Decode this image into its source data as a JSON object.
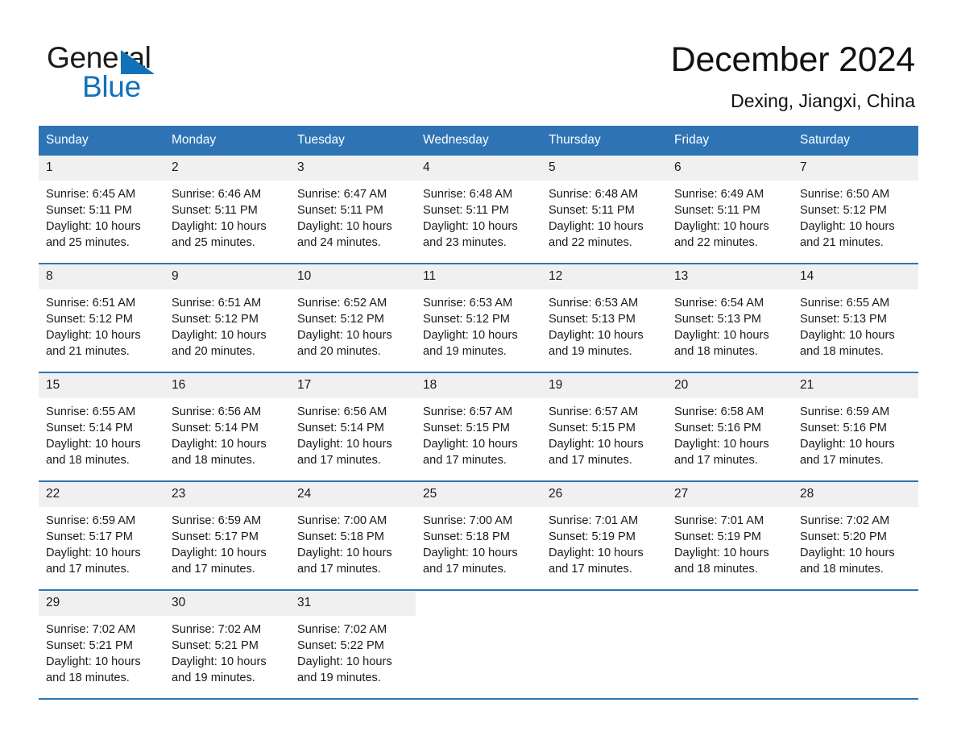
{
  "brand": {
    "name_top": "General",
    "name_bottom": "Blue",
    "triangle_color": "#1172ba"
  },
  "header": {
    "title": "December 2024",
    "subtitle": "Dexing, Jiangxi, China"
  },
  "theme": {
    "header_blue": "#2e74b5",
    "daynum_band": "#f0f0f0",
    "text": "#1a1a1a"
  },
  "weekdays": [
    "Sunday",
    "Monday",
    "Tuesday",
    "Wednesday",
    "Thursday",
    "Friday",
    "Saturday"
  ],
  "weeks": [
    [
      {
        "day": "1",
        "sunrise": "Sunrise: 6:45 AM",
        "sunset": "Sunset: 5:11 PM",
        "daylight_1": "Daylight: 10 hours",
        "daylight_2": "and 25 minutes."
      },
      {
        "day": "2",
        "sunrise": "Sunrise: 6:46 AM",
        "sunset": "Sunset: 5:11 PM",
        "daylight_1": "Daylight: 10 hours",
        "daylight_2": "and 25 minutes."
      },
      {
        "day": "3",
        "sunrise": "Sunrise: 6:47 AM",
        "sunset": "Sunset: 5:11 PM",
        "daylight_1": "Daylight: 10 hours",
        "daylight_2": "and 24 minutes."
      },
      {
        "day": "4",
        "sunrise": "Sunrise: 6:48 AM",
        "sunset": "Sunset: 5:11 PM",
        "daylight_1": "Daylight: 10 hours",
        "daylight_2": "and 23 minutes."
      },
      {
        "day": "5",
        "sunrise": "Sunrise: 6:48 AM",
        "sunset": "Sunset: 5:11 PM",
        "daylight_1": "Daylight: 10 hours",
        "daylight_2": "and 22 minutes."
      },
      {
        "day": "6",
        "sunrise": "Sunrise: 6:49 AM",
        "sunset": "Sunset: 5:11 PM",
        "daylight_1": "Daylight: 10 hours",
        "daylight_2": "and 22 minutes."
      },
      {
        "day": "7",
        "sunrise": "Sunrise: 6:50 AM",
        "sunset": "Sunset: 5:12 PM",
        "daylight_1": "Daylight: 10 hours",
        "daylight_2": "and 21 minutes."
      }
    ],
    [
      {
        "day": "8",
        "sunrise": "Sunrise: 6:51 AM",
        "sunset": "Sunset: 5:12 PM",
        "daylight_1": "Daylight: 10 hours",
        "daylight_2": "and 21 minutes."
      },
      {
        "day": "9",
        "sunrise": "Sunrise: 6:51 AM",
        "sunset": "Sunset: 5:12 PM",
        "daylight_1": "Daylight: 10 hours",
        "daylight_2": "and 20 minutes."
      },
      {
        "day": "10",
        "sunrise": "Sunrise: 6:52 AM",
        "sunset": "Sunset: 5:12 PM",
        "daylight_1": "Daylight: 10 hours",
        "daylight_2": "and 20 minutes."
      },
      {
        "day": "11",
        "sunrise": "Sunrise: 6:53 AM",
        "sunset": "Sunset: 5:12 PM",
        "daylight_1": "Daylight: 10 hours",
        "daylight_2": "and 19 minutes."
      },
      {
        "day": "12",
        "sunrise": "Sunrise: 6:53 AM",
        "sunset": "Sunset: 5:13 PM",
        "daylight_1": "Daylight: 10 hours",
        "daylight_2": "and 19 minutes."
      },
      {
        "day": "13",
        "sunrise": "Sunrise: 6:54 AM",
        "sunset": "Sunset: 5:13 PM",
        "daylight_1": "Daylight: 10 hours",
        "daylight_2": "and 18 minutes."
      },
      {
        "day": "14",
        "sunrise": "Sunrise: 6:55 AM",
        "sunset": "Sunset: 5:13 PM",
        "daylight_1": "Daylight: 10 hours",
        "daylight_2": "and 18 minutes."
      }
    ],
    [
      {
        "day": "15",
        "sunrise": "Sunrise: 6:55 AM",
        "sunset": "Sunset: 5:14 PM",
        "daylight_1": "Daylight: 10 hours",
        "daylight_2": "and 18 minutes."
      },
      {
        "day": "16",
        "sunrise": "Sunrise: 6:56 AM",
        "sunset": "Sunset: 5:14 PM",
        "daylight_1": "Daylight: 10 hours",
        "daylight_2": "and 18 minutes."
      },
      {
        "day": "17",
        "sunrise": "Sunrise: 6:56 AM",
        "sunset": "Sunset: 5:14 PM",
        "daylight_1": "Daylight: 10 hours",
        "daylight_2": "and 17 minutes."
      },
      {
        "day": "18",
        "sunrise": "Sunrise: 6:57 AM",
        "sunset": "Sunset: 5:15 PM",
        "daylight_1": "Daylight: 10 hours",
        "daylight_2": "and 17 minutes."
      },
      {
        "day": "19",
        "sunrise": "Sunrise: 6:57 AM",
        "sunset": "Sunset: 5:15 PM",
        "daylight_1": "Daylight: 10 hours",
        "daylight_2": "and 17 minutes."
      },
      {
        "day": "20",
        "sunrise": "Sunrise: 6:58 AM",
        "sunset": "Sunset: 5:16 PM",
        "daylight_1": "Daylight: 10 hours",
        "daylight_2": "and 17 minutes."
      },
      {
        "day": "21",
        "sunrise": "Sunrise: 6:59 AM",
        "sunset": "Sunset: 5:16 PM",
        "daylight_1": "Daylight: 10 hours",
        "daylight_2": "and 17 minutes."
      }
    ],
    [
      {
        "day": "22",
        "sunrise": "Sunrise: 6:59 AM",
        "sunset": "Sunset: 5:17 PM",
        "daylight_1": "Daylight: 10 hours",
        "daylight_2": "and 17 minutes."
      },
      {
        "day": "23",
        "sunrise": "Sunrise: 6:59 AM",
        "sunset": "Sunset: 5:17 PM",
        "daylight_1": "Daylight: 10 hours",
        "daylight_2": "and 17 minutes."
      },
      {
        "day": "24",
        "sunrise": "Sunrise: 7:00 AM",
        "sunset": "Sunset: 5:18 PM",
        "daylight_1": "Daylight: 10 hours",
        "daylight_2": "and 17 minutes."
      },
      {
        "day": "25",
        "sunrise": "Sunrise: 7:00 AM",
        "sunset": "Sunset: 5:18 PM",
        "daylight_1": "Daylight: 10 hours",
        "daylight_2": "and 17 minutes."
      },
      {
        "day": "26",
        "sunrise": "Sunrise: 7:01 AM",
        "sunset": "Sunset: 5:19 PM",
        "daylight_1": "Daylight: 10 hours",
        "daylight_2": "and 17 minutes."
      },
      {
        "day": "27",
        "sunrise": "Sunrise: 7:01 AM",
        "sunset": "Sunset: 5:19 PM",
        "daylight_1": "Daylight: 10 hours",
        "daylight_2": "and 18 minutes."
      },
      {
        "day": "28",
        "sunrise": "Sunrise: 7:02 AM",
        "sunset": "Sunset: 5:20 PM",
        "daylight_1": "Daylight: 10 hours",
        "daylight_2": "and 18 minutes."
      }
    ],
    [
      {
        "day": "29",
        "sunrise": "Sunrise: 7:02 AM",
        "sunset": "Sunset: 5:21 PM",
        "daylight_1": "Daylight: 10 hours",
        "daylight_2": "and 18 minutes."
      },
      {
        "day": "30",
        "sunrise": "Sunrise: 7:02 AM",
        "sunset": "Sunset: 5:21 PM",
        "daylight_1": "Daylight: 10 hours",
        "daylight_2": "and 19 minutes."
      },
      {
        "day": "31",
        "sunrise": "Sunrise: 7:02 AM",
        "sunset": "Sunset: 5:22 PM",
        "daylight_1": "Daylight: 10 hours",
        "daylight_2": "and 19 minutes."
      },
      {
        "day": "",
        "sunrise": "",
        "sunset": "",
        "daylight_1": "",
        "daylight_2": ""
      },
      {
        "day": "",
        "sunrise": "",
        "sunset": "",
        "daylight_1": "",
        "daylight_2": ""
      },
      {
        "day": "",
        "sunrise": "",
        "sunset": "",
        "daylight_1": "",
        "daylight_2": ""
      },
      {
        "day": "",
        "sunrise": "",
        "sunset": "",
        "daylight_1": "",
        "daylight_2": ""
      }
    ]
  ]
}
